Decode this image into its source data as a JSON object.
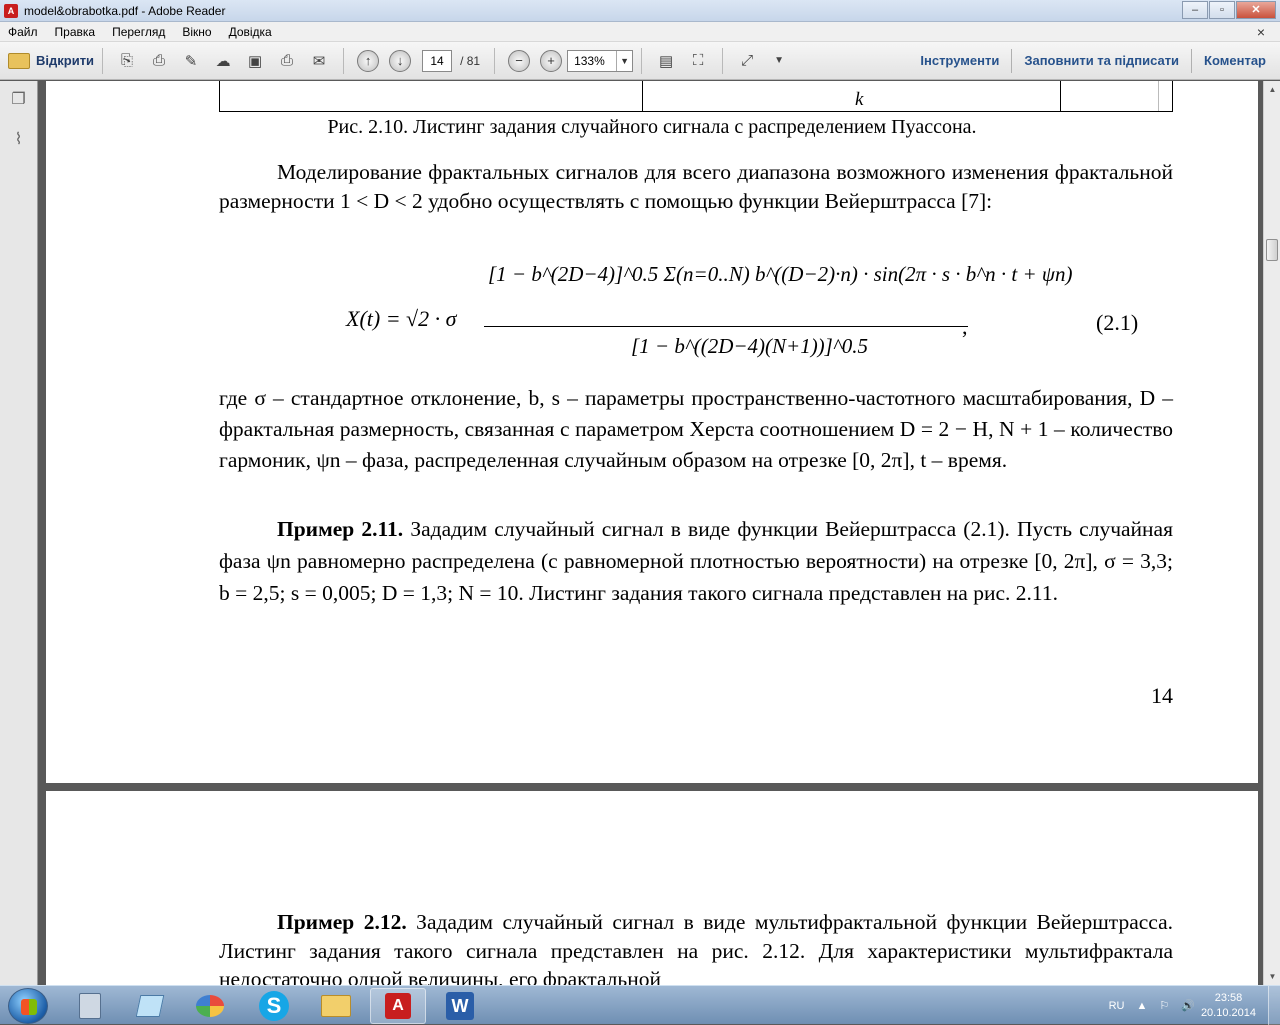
{
  "window": {
    "title": "model&obrabotka.pdf - Adobe Reader",
    "buttons": {
      "minimize": "‒",
      "maximize": "▫",
      "close": "✕"
    }
  },
  "menu": [
    "Файл",
    "Правка",
    "Перегляд",
    "Вікно",
    "Довідка"
  ],
  "menu_close": "×",
  "toolbar": {
    "open_label": "Відкрити",
    "page_current": "14",
    "page_total": "/ 81",
    "zoom": "133%",
    "tools_label": "Інструменти",
    "fill_sign_label": "Заповнити та підписати",
    "comment_label": "Коментар"
  },
  "page1": {
    "table_cell": "k",
    "caption": "Рис. 2.10. Листинг задания случайного сигнала с распределением Пуассона.",
    "intro": "Моделирование фрактальных сигналов для всего диапазона возможного изменения фрактальной размерности 1 < D < 2 удобно осуществлять с помощью функции Вейерштрасса [7]:",
    "formula": {
      "lhs": "X(t) = √2 · σ",
      "numerator": "[1 − b^(2D−4)]^0.5 Σ(n=0..N) b^((D−2)·n) · sin(2π · s · b^n · t + ψn)",
      "denominator": "[1 − b^((2D−4)(N+1))]^0.5",
      "comma": ",",
      "number": "(2.1)"
    },
    "where_text": "где σ – стандартное отклонение, b, s – параметры пространственно-частотного масштабирования, D – фрактальная размерность, связанная с параметром Херста соотношением D = 2 − H, N + 1 – количество гармоник, ψn – фаза, распределенная случайным образом на отрезке [0, 2π], t – время.",
    "example_title": "Пример 2.11.",
    "example_text": " Зададим случайный сигнал в виде функции Вейерштрасса (2.1). Пусть случайная фаза ψn равномерно распределена (с равномерной плотностью вероятности) на отрезке [0, 2π], σ = 3,3; b = 2,5; s = 0,005; D = 1,3; N = 10. Листинг задания такого сигнала представлен на рис. 2.11.",
    "page_number": "14"
  },
  "page2": {
    "example_title": "Пример 2.12.",
    "example_text": " Зададим случайный сигнал в виде мультифрактальной функции Вейерштрасса. Листинг задания такого сигнала представлен на рис. 2.12. Для характеристики мультифрактала недостаточно одной величины, его фрактальной"
  },
  "taskbar": {
    "lang": "RU",
    "time": "23:58",
    "date": "20.10.2014",
    "apps": [
      "calculator-app",
      "notepad-app",
      "paint-app",
      "skype-app",
      "explorer-app",
      "acrobat-app",
      "word-app"
    ],
    "skype_letter": "S",
    "word_letter": "W",
    "tray_flag": "⚐",
    "tray_volume": "🔊"
  },
  "colors": {
    "accent_link": "#27528c",
    "document_background": "#595959",
    "acrobat_red": "#c81e1e"
  }
}
